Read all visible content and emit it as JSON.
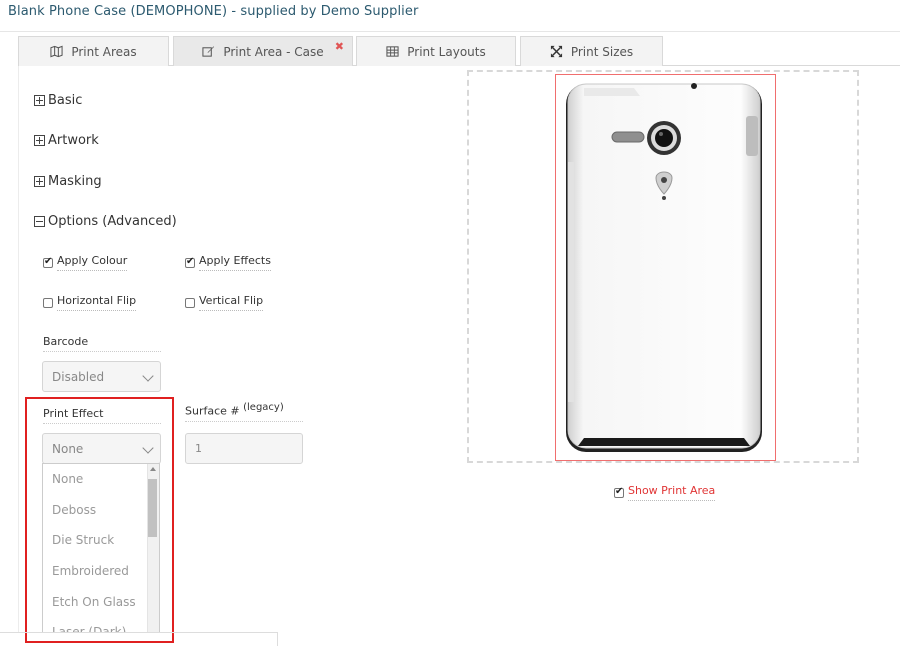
{
  "header": {
    "title": "Blank Phone Case (DEMOPHONE) - supplied by Demo Supplier"
  },
  "tabs": [
    {
      "label": "Print Areas",
      "icon": "map-icon"
    },
    {
      "label": "Print Area - Case",
      "icon": "edit-icon",
      "close": "✖"
    },
    {
      "label": "Print Layouts",
      "icon": "table-icon"
    },
    {
      "label": "Print Sizes",
      "icon": "resize-icon"
    }
  ],
  "sections": {
    "basic": "Basic",
    "artwork": "Artwork",
    "masking": "Masking",
    "options": "Options (Advanced)"
  },
  "options": {
    "apply_colour": {
      "label": "Apply Colour",
      "checked": true
    },
    "apply_effects": {
      "label": "Apply Effects",
      "checked": true
    },
    "horizontal_flip": {
      "label": "Horizontal Flip",
      "checked": false
    },
    "vertical_flip": {
      "label": "Vertical Flip",
      "checked": false
    },
    "barcode": {
      "label": "Barcode",
      "value": "Disabled"
    },
    "print_effect": {
      "label": "Print Effect",
      "value": "None",
      "options": [
        "None",
        "Deboss",
        "Die Struck",
        "Embroidered",
        "Etch On Glass",
        "Laser (Dark)"
      ]
    },
    "surface": {
      "label": "Surface #",
      "sup": "(legacy)",
      "value": "1"
    }
  },
  "preview": {
    "show_print_area": {
      "label": "Show Print Area",
      "checked": true
    }
  },
  "colors": {
    "accent": "#2c5a6f",
    "highlight": "#e02020",
    "print_area": "#f06e6e"
  }
}
